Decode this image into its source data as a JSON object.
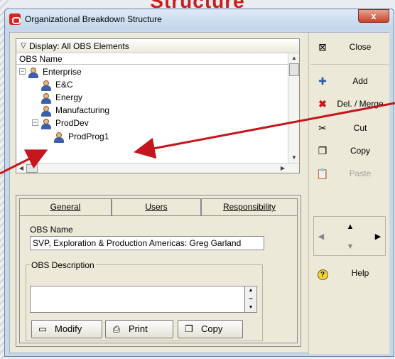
{
  "backdrop": {
    "title_fragment": "Structure"
  },
  "window": {
    "title": "Organizational Breakdown Structure",
    "close_glyph": "x"
  },
  "tree": {
    "display_filter": "Display: All OBS Elements",
    "column_header": "OBS Name",
    "nodes": [
      {
        "label": "Enterprise",
        "level": 0,
        "expander": "−"
      },
      {
        "label": "E&C",
        "level": 1,
        "expander": ""
      },
      {
        "label": "Energy",
        "level": 1,
        "expander": ""
      },
      {
        "label": "Manufacturing",
        "level": 1,
        "expander": ""
      },
      {
        "label": "ProdDev",
        "level": 1,
        "expander": "−"
      },
      {
        "label": "ProdProg1",
        "level": 2,
        "expander": ""
      }
    ]
  },
  "tabs": {
    "items": [
      "General",
      "Users",
      "Responsibility"
    ],
    "active": "General"
  },
  "general": {
    "obs_name_label": "OBS Name",
    "obs_name_value": "SVP, Exploration & Production Americas: Greg Garland",
    "obs_description_label": "OBS Description",
    "obs_description_value": "",
    "modify_label": "Modify",
    "print_label": "Print",
    "copy_label": "Copy"
  },
  "side": {
    "close": "Close",
    "add": "Add",
    "del_merge": "Del. / Merge",
    "cut": "Cut",
    "copy": "Copy",
    "paste": "Paste",
    "help": "Help"
  },
  "colors": {
    "accent_red": "#d11a1a",
    "arrow_red": "#c4161c"
  }
}
